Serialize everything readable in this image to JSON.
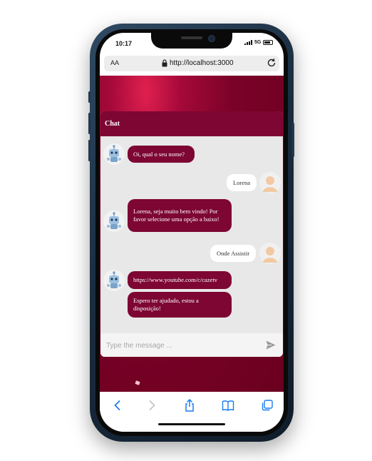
{
  "status_bar": {
    "time": "10:17",
    "network": "5G"
  },
  "browser": {
    "text_size_label": "AA",
    "url": "http://localhost:3000"
  },
  "chat": {
    "title": "Chat",
    "messages": [
      {
        "sender": "bot",
        "text": "Oi, qual o seu nome?"
      },
      {
        "sender": "user",
        "text": "Lorena"
      },
      {
        "sender": "bot",
        "text": "Lorena, seja muito bem vindo! Por favor selecione uma opção a baixo!"
      },
      {
        "sender": "user",
        "text": "Onde Assistir"
      },
      {
        "sender": "bot",
        "text": "https://www.youtube.com/c/cazetv"
      },
      {
        "sender": "bot",
        "text": "Espero ter ajudado, estou a disposição!"
      }
    ],
    "input_placeholder": "Type the message ..."
  },
  "colors": {
    "accent": "#7d0633",
    "chat_background": "#e8e8e8",
    "ios_blue": "#1a7cf0"
  },
  "icons": [
    "lock-icon",
    "reload-icon",
    "bot-avatar",
    "user-avatar",
    "send-icon",
    "back-icon",
    "forward-icon",
    "share-icon",
    "bookmarks-icon",
    "tabs-icon"
  ]
}
